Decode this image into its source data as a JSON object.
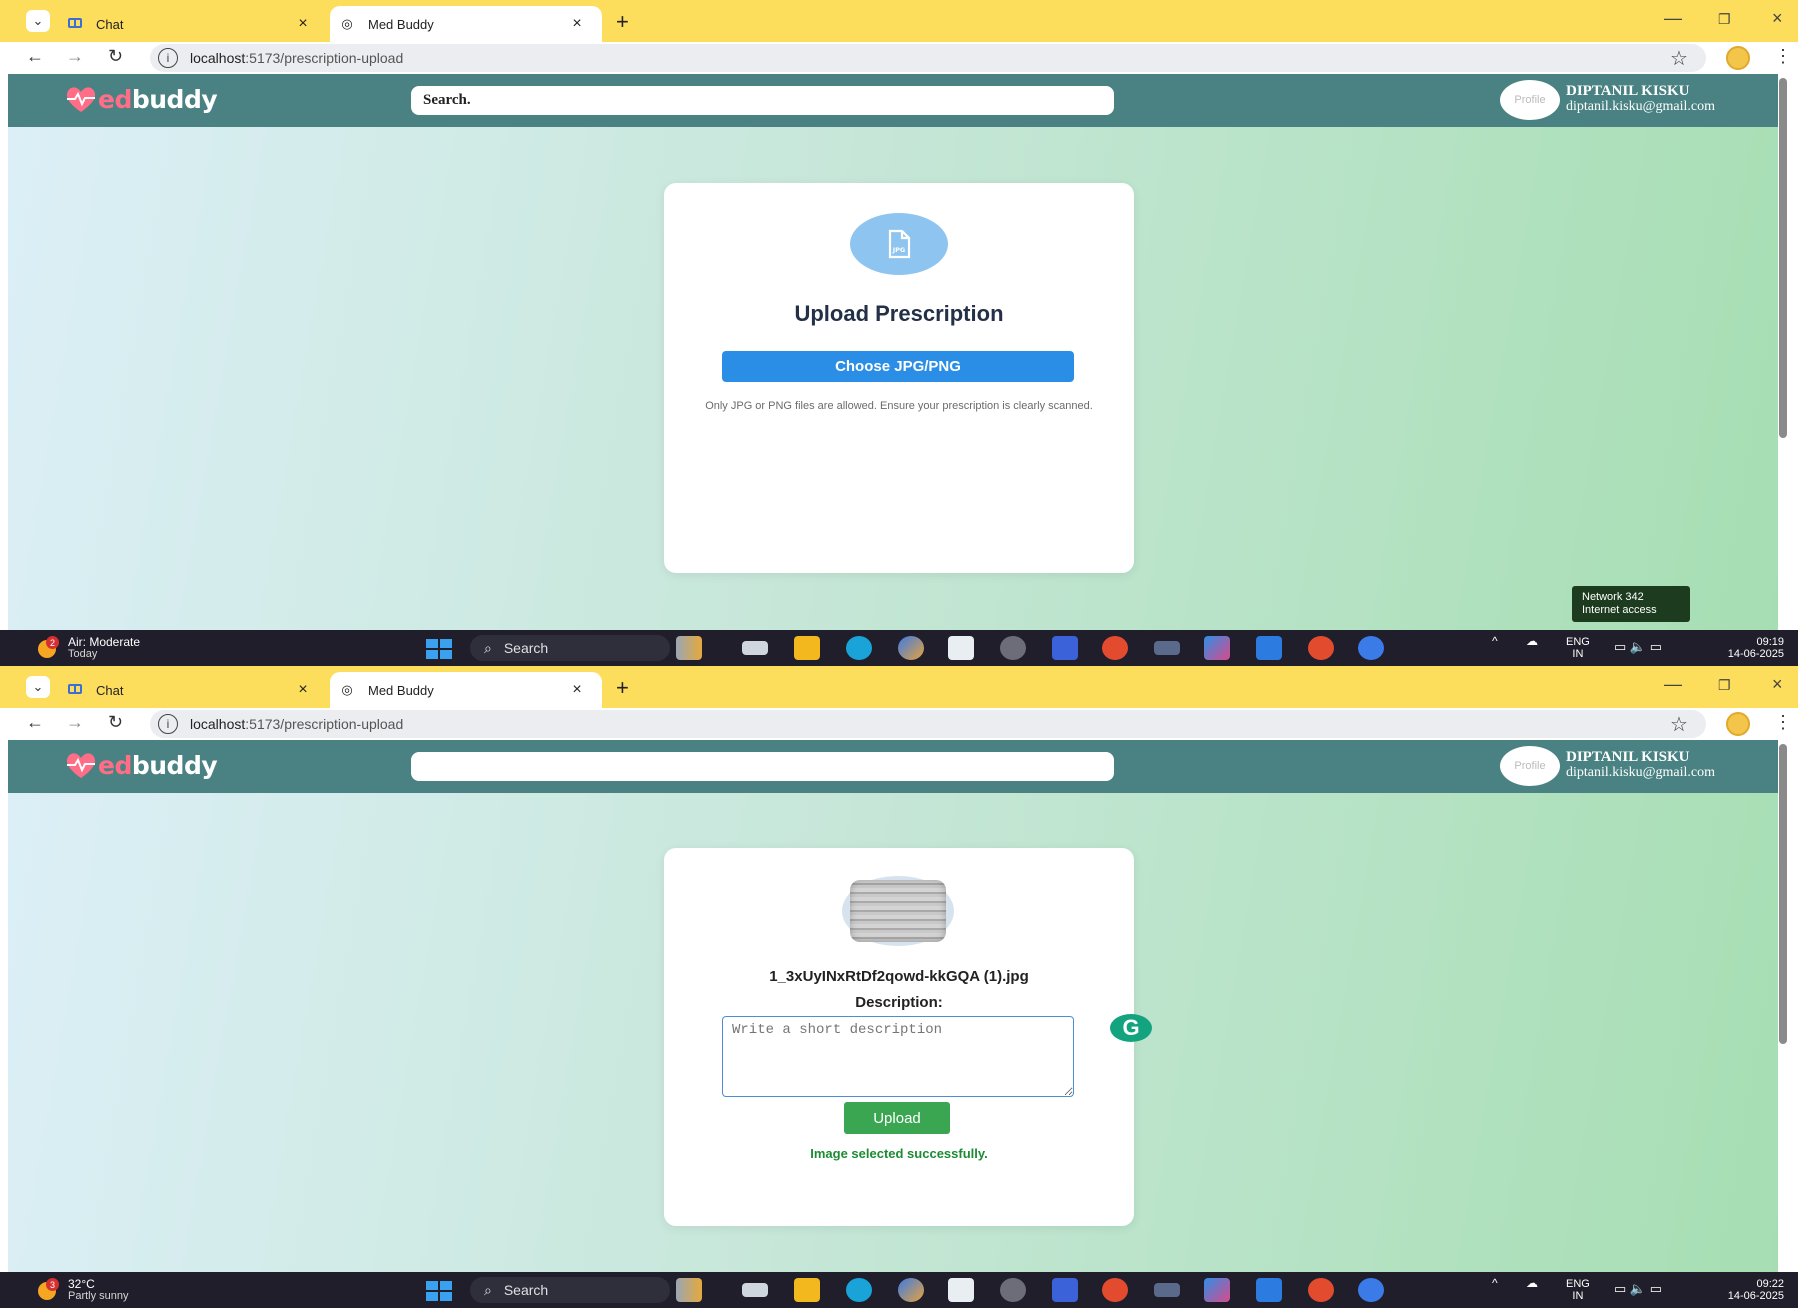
{
  "panels": [
    {
      "browser": {
        "tabs": [
          {
            "label": "Chat",
            "icon": "chat-icon"
          },
          {
            "label": "Med Buddy",
            "icon": "globe-icon"
          }
        ],
        "url_host": "localhost",
        "url_path": ":5173/prescription-upload"
      },
      "app": {
        "logo_part1": "ed",
        "logo_part2": "buddy",
        "search_value": "Search.",
        "user_name": "DIPTANIL KISKU",
        "user_email": "diptanil.kisku@gmail.com",
        "avatar_alt": "Profile",
        "card": {
          "title": "Upload Prescription",
          "icon_label": "JPG",
          "choose_button": "Choose JPG/PNG",
          "note": "Only JPG or PNG files are allowed. Ensure your prescription is clearly scanned."
        },
        "network_tooltip": {
          "line1": "Network 342",
          "line2": "Internet access"
        }
      },
      "taskbar": {
        "weather_title": "Air: Moderate",
        "weather_sub": "Today",
        "weather_badge": "2",
        "search_label": "Search",
        "lang_top": "ENG",
        "lang_bottom": "IN",
        "time": "09:19",
        "date": "14-06-2025"
      }
    },
    {
      "browser": {
        "tabs": [
          {
            "label": "Chat",
            "icon": "chat-icon"
          },
          {
            "label": "Med Buddy",
            "icon": "globe-icon"
          }
        ],
        "url_host": "localhost",
        "url_path": ":5173/prescription-upload"
      },
      "app": {
        "logo_part1": "ed",
        "logo_part2": "buddy",
        "search_value": "",
        "user_name": "DIPTANIL KISKU",
        "user_email": "diptanil.kisku@gmail.com",
        "avatar_alt": "Profile",
        "card": {
          "file_name": "1_3xUyINxRtDf2qowd-kkGQA (1).jpg",
          "description_label": "Description:",
          "description_placeholder": "Write a short description",
          "upload_button": "Upload",
          "success_message": "Image selected successfully."
        },
        "grammarly_letter": "G"
      },
      "taskbar": {
        "weather_title": "32°C",
        "weather_sub": "Partly sunny",
        "weather_badge": "3",
        "search_label": "Search",
        "lang_top": "ENG",
        "lang_bottom": "IN",
        "time": "09:22",
        "date": "14-06-2025"
      }
    }
  ],
  "colors": {
    "chrome_tabstrip": "#fddd5c",
    "app_header": "#4a8283",
    "choose_button": "#2a8ee6",
    "upload_button": "#3aa651",
    "success_text": "#1c8b34",
    "logo_accent": "#ff6e86"
  }
}
